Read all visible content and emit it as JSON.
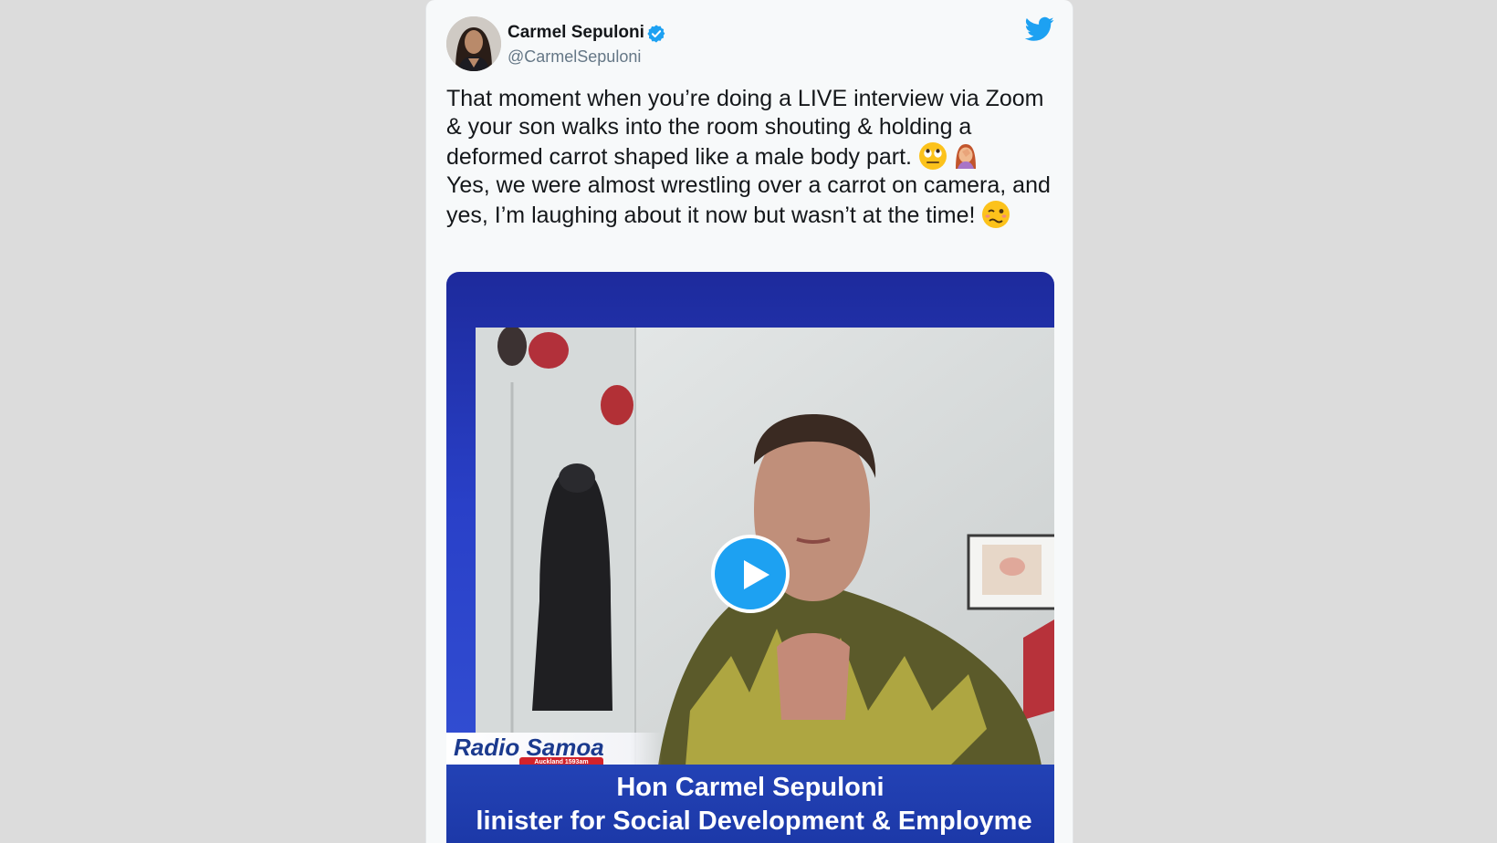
{
  "tweet": {
    "author_name": "Carmel Sepuloni",
    "author_handle": "@CarmelSepuloni",
    "text_line1": "That moment when you’re doing a LIVE interview via Zoom & your son walks into the room shouting & holding a deformed carrot shaped like a male body part.",
    "text_line2": "Yes, we were almost wrestling over a carrot on camera, and yes, I’m laughing about it now but wasn’t at the time!",
    "emojis": [
      "face-with-rolling-eyes",
      "woman-facepalming",
      "woozy-face"
    ]
  },
  "video": {
    "broadcaster": "Radio Samoa",
    "broadcaster_sub": "Auckland 1593am",
    "caption_name": "Hon Carmel Sepuloni",
    "caption_title": "linister for Social Development & Employme"
  },
  "colors": {
    "twitter_blue": "#1da1f2",
    "lower_third": "#1b37a6",
    "background": "#dcdcdc"
  },
  "icons": {
    "verified": "verified-badge-icon",
    "brand": "twitter-bird-icon",
    "play": "play-icon"
  }
}
